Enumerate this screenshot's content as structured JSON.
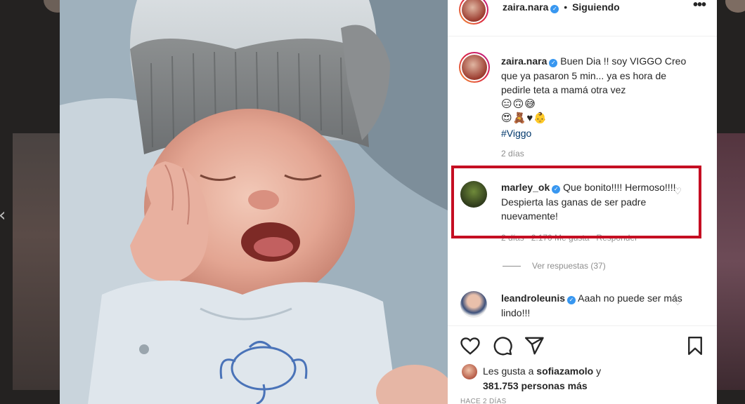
{
  "post": {
    "author": "zaira.nara",
    "follow_state": "Siguiendo",
    "separator": "•"
  },
  "caption": {
    "author": "zaira.nara",
    "text": "Buen Dia !! soy VIGGO Creo que ya pasaron 5 min... ya es hora de pedirle teta a mamá otra vez",
    "emojis_line1": "😑🙃😅",
    "emojis_line2": "😍🧸♥👶",
    "hashtag": "#Viggo",
    "time": "2 días"
  },
  "comments": [
    {
      "author": "marley_ok",
      "text": "Que bonito!!!! Hermoso!!!! Despierta las ganas de ser padre nuevamente!",
      "meta": "2 días   2.170 Me gusta   Responder"
    },
    {
      "author": "leandroleunis",
      "text": "Aaah no puede ser más lindo!!!"
    }
  ],
  "replies": {
    "label": "Ver respuestas (37)"
  },
  "likes": {
    "prefix": "Les gusta a",
    "user": "sofiazamolo",
    "conj": "y",
    "count": "381.753 personas más"
  },
  "date": "HACE 2 DÍAS",
  "colors": {
    "highlight": "#c50e22",
    "verified": "#3897f0",
    "hashtag": "#00376b",
    "muted": "#8e8e8e"
  },
  "icons": [
    "more-options-icon",
    "heart-icon",
    "comment-icon",
    "share-icon",
    "save-icon",
    "verified-icon",
    "previous-arrow-icon"
  ]
}
